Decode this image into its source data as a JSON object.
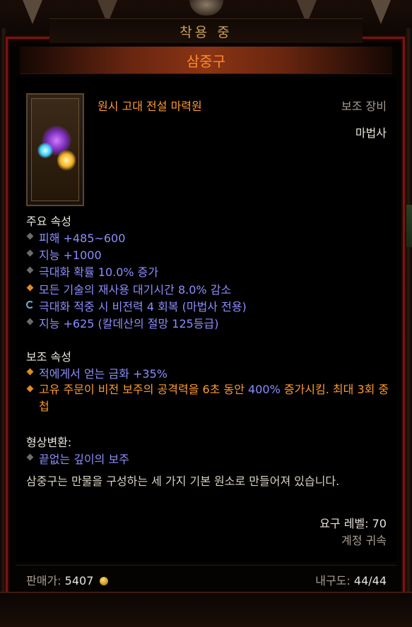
{
  "header": {
    "equipped_label": "착용 중"
  },
  "item": {
    "name": "삼중구",
    "quality_type": "원시 고대 전설 마력원",
    "slot_type": "보조 장비",
    "class_restriction": "마법사"
  },
  "primary": {
    "title": "주요 속성",
    "attributes": [
      {
        "text": "피해 +485~600",
        "bullet": "grey"
      },
      {
        "text": "지능 +1000",
        "bullet": "grey"
      },
      {
        "text": "극대화 확률 10.0% 증가",
        "bullet": "grey"
      },
      {
        "text": "모든 기술의 재사용 대기시간 8.0% 감소",
        "bullet": "gold"
      },
      {
        "text": "극대화 적중 시 비전력 4 회복 (마법사 전용)",
        "bullet": "cycle"
      },
      {
        "text": "지능 +625 (칼데산의 절망 125등급)",
        "bullet": "grey"
      }
    ]
  },
  "secondary": {
    "title": "보조 속성",
    "attr1": "적에게서 얻는 금화 +35%",
    "legendary_part1": "고유 주문이 비전 보주의 공격력을 6초 동안 ",
    "legendary_highlight": "400%",
    "legendary_part2": " 증가시킴. 최대 3회 중첩"
  },
  "transmog": {
    "title": "형상변환:",
    "value": "끝없는 깊이의 보주"
  },
  "flavor_text": "삼중구는 만물을 구성하는 세 가지 기본 원소로 만들어져 있습니다.",
  "requirements": {
    "level_label": "요구 레벨: 70",
    "bound_label": "계정 귀속"
  },
  "footer": {
    "sell_label": "판매가:",
    "sell_value": "5407",
    "durability_label": "내구도:",
    "durability_value": "44/44"
  },
  "colors": {
    "legendary_orange": "#ff9a2e",
    "magic_blue": "#8d8dff",
    "border_red": "#7a1410"
  },
  "icons": [
    "orb-item-icon",
    "gold-coin-icon",
    "diamond-bullet-icon",
    "cycle-bullet-icon"
  ]
}
